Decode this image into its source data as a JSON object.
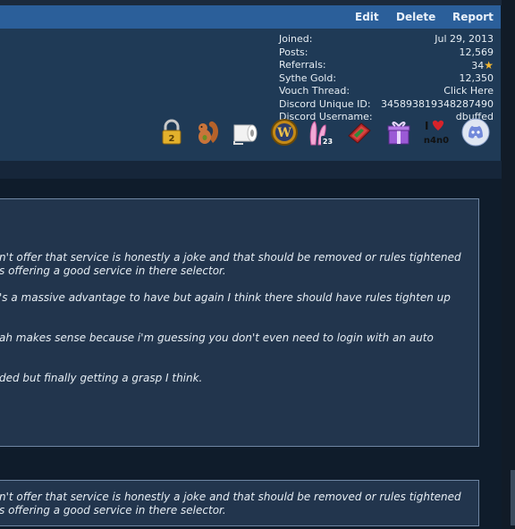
{
  "actions": {
    "edit": "Edit",
    "delete": "Delete",
    "report": "Report"
  },
  "userinfo": {
    "joined_label": "Joined:",
    "joined_value": "Jul 29, 2013",
    "posts_label": "Posts:",
    "posts_value": "12,569",
    "referrals_label": "Referrals:",
    "referrals_value": "34",
    "gold_label": "Sythe Gold:",
    "gold_value": "12,350",
    "vouch_label": "Vouch Thread:",
    "vouch_value": "Click Here",
    "discord_id_label": "Discord Unique ID:",
    "discord_id_value": "345893819348287490",
    "discord_user_label": "Discord Username:",
    "discord_user_value": "dbuffed"
  },
  "badges": {
    "lock": "lock-icon",
    "squirrel": "squirrel-icon",
    "toilet": "toilet-paper-icon",
    "wow": "world-of-warcraft-icon",
    "bunny": "bunny-ears-icon",
    "bunny_count": "23",
    "book": "red-book-icon",
    "gift": "gift-icon",
    "heart_text": "n4n0",
    "discord": "discord-icon"
  },
  "post1": {
    "line1": "n't offer that service is honestly a joke and that should be removed or rules tightened",
    "line2": "s offering a good service in there selector.",
    "line3": "'s a massive advantage to have but again I think there should have rules tighten up",
    "line4": "ah makes sense because i'm guessing you don't even need to login with an auto",
    "line5": "ded but finally getting a grasp I think."
  },
  "post2": {
    "line1": "n't offer that service is honestly a joke and that should be removed or rules tightened",
    "line2": "s offering a good service in there selector."
  },
  "colors": {
    "actionbar": "#2b5f9a",
    "panel": "#1f3a56",
    "post": "#22354d"
  }
}
